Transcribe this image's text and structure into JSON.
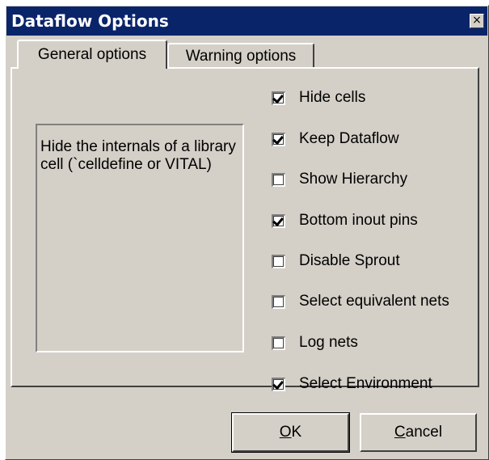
{
  "window": {
    "title": "Dataflow Options",
    "close_glyph": "×"
  },
  "tabs": [
    {
      "label": "General options",
      "selected": true
    },
    {
      "label": "Warning options",
      "selected": false
    }
  ],
  "description": "Hide the internals of a library cell (`celldefine or VITAL)",
  "options": [
    {
      "label": "Hide cells",
      "checked": true
    },
    {
      "label": "Keep Dataflow",
      "checked": true
    },
    {
      "label": "Show Hierarchy",
      "checked": false
    },
    {
      "label": "Bottom inout pins",
      "checked": true
    },
    {
      "label": "Disable Sprout",
      "checked": false
    },
    {
      "label": "Select equivalent nets",
      "checked": false
    },
    {
      "label": "Log nets",
      "checked": false
    },
    {
      "label": "Select Environment",
      "checked": true
    }
  ],
  "buttons": {
    "ok": "OK",
    "cancel": "Cancel"
  },
  "colors": {
    "titlebar": "#0a246a",
    "face": "#d4d0c8"
  }
}
